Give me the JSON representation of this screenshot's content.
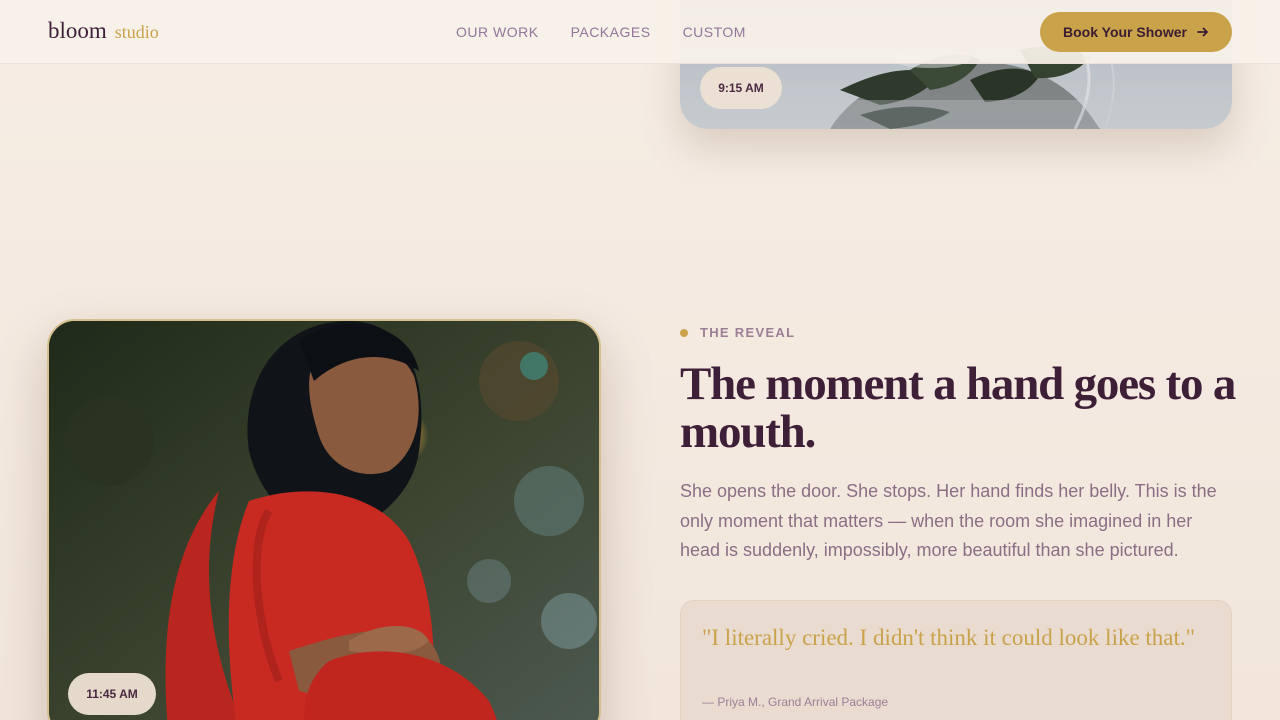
{
  "brand": {
    "name": "bloom",
    "sub": "studio"
  },
  "nav": {
    "links": [
      {
        "label": "OUR WORK"
      },
      {
        "label": "PACKAGES"
      },
      {
        "label": "CUSTOM"
      }
    ],
    "cta_label": "Book Your Shower",
    "cta_icon": "arrow-right-icon"
  },
  "gallery": {
    "top_photo": {
      "time": "9:15 AM"
    },
    "main_photo": {
      "time": "11:45 AM"
    }
  },
  "reveal": {
    "eyebrow": "THE REVEAL",
    "headline": "The moment a hand goes to a mouth.",
    "body": "She opens the door. She stops. Her hand finds her belly. This is the only moment that matters — when the room she imagined in her head is suddenly, impossibly, more beautiful than she pictured.",
    "quote": {
      "text": "\"I literally cried. I didn't think it could look like that.\"",
      "attribution": "— Priya M., Grand Arrival Package"
    }
  },
  "colors": {
    "accent_gold": "#c9a24a",
    "plum": "#3e1f38",
    "muted_mauve": "#8a6f84",
    "background": "#f4eae1"
  }
}
